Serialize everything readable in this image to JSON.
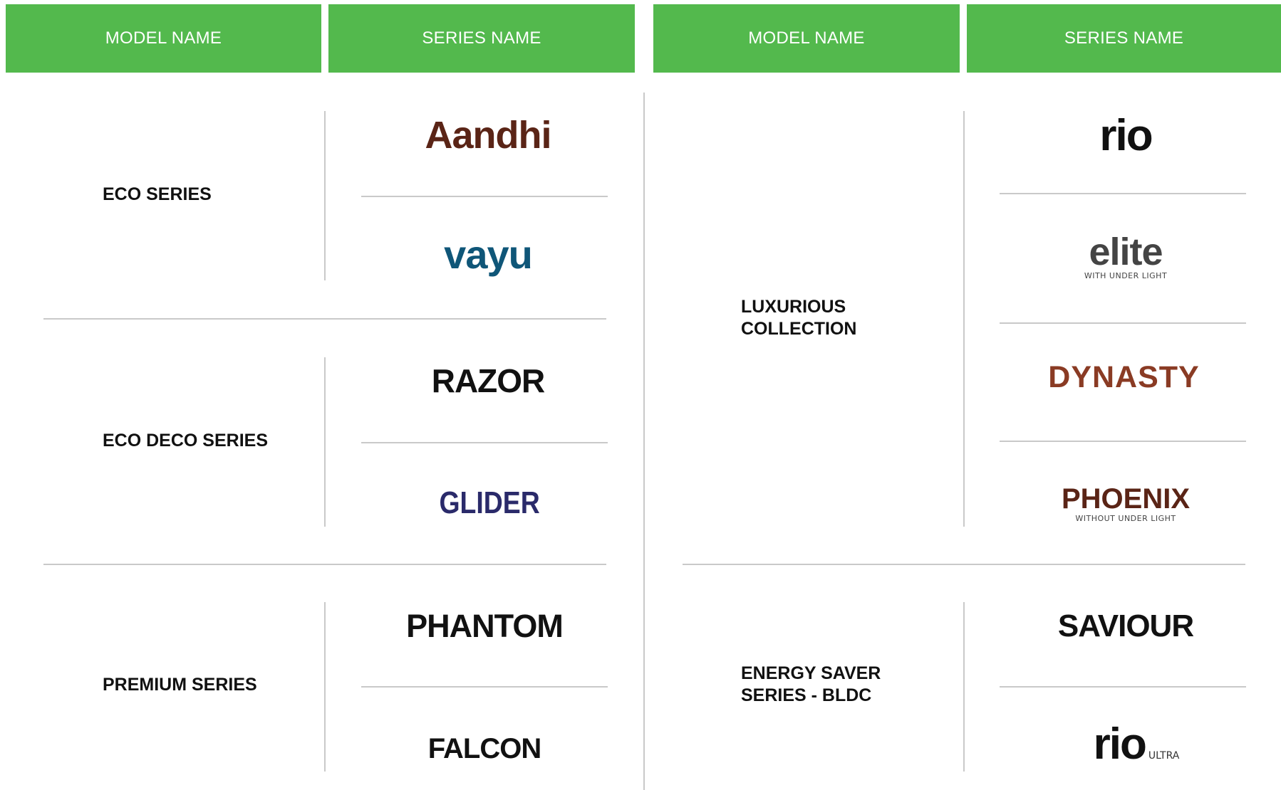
{
  "headers": [
    "MODEL NAME",
    "SERIES NAME",
    "MODEL NAME",
    "SERIES NAME"
  ],
  "left_column": [
    {
      "model": "ECO SERIES",
      "series": [
        "Aandhi",
        "vayu"
      ]
    },
    {
      "model": "ECO DECO SERIES",
      "series": [
        "RAZOR",
        "GLIDER"
      ]
    },
    {
      "model": "PREMIUM SERIES",
      "series": [
        "PHANTOM",
        "FALCON"
      ]
    }
  ],
  "right_column": [
    {
      "model": "LUXURIOUS COLLECTION",
      "series": [
        "rio",
        "elite",
        "DYNASTY",
        "PHOENIX"
      ]
    },
    {
      "model": "ENERGY SAVER SERIES - BLDC",
      "series": [
        "SAVIOUR",
        "rio"
      ]
    }
  ],
  "logo_subtitles": {
    "elite": "WITH UNDER LIGHT",
    "phoenix": "WITHOUT UNDER LIGHT",
    "rio_ultra": "ULTRA"
  },
  "colors": {
    "header_green": "#53b94d",
    "aandhi": "#5a2416",
    "vayu": "#0f5678",
    "glider": "#2a2a6a",
    "dynasty_accent": "#8a3b24",
    "rio_dot": "#53b94d"
  }
}
